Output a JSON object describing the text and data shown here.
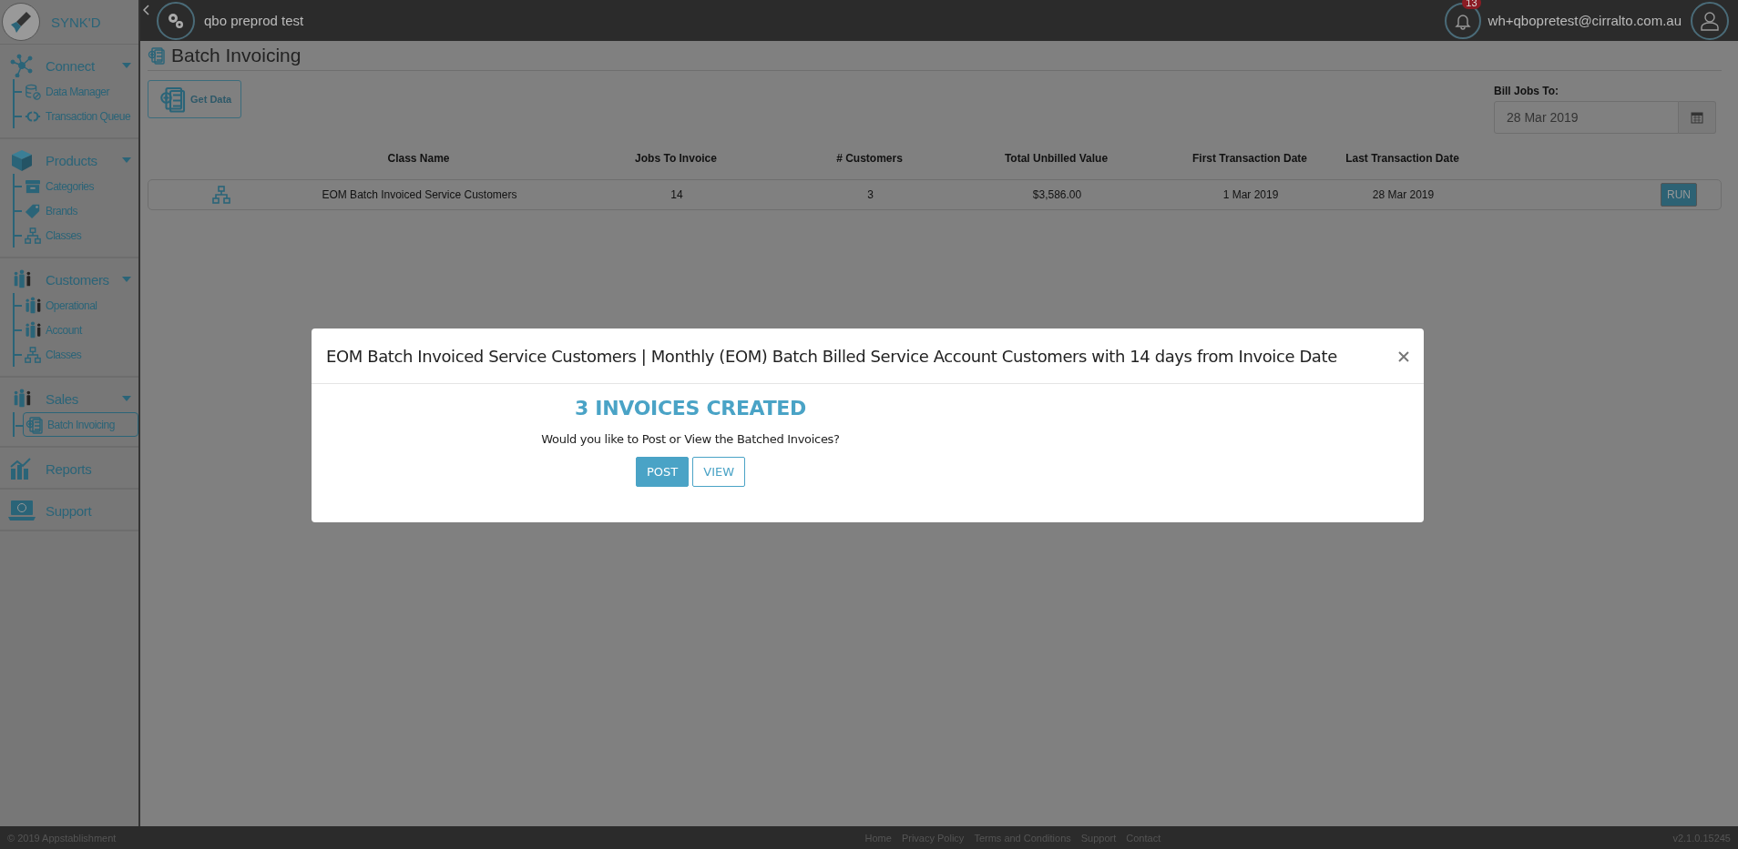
{
  "sidebar": {
    "brand": "SYNK'D",
    "groups": [
      {
        "label": "Connect",
        "expanded": true,
        "children": [
          {
            "label": "Data Manager",
            "selected": false
          },
          {
            "label": "Transaction Queue",
            "selected": false
          }
        ]
      },
      {
        "label": "Products",
        "expanded": true,
        "children": [
          {
            "label": "Categories",
            "selected": false
          },
          {
            "label": "Brands",
            "selected": false
          },
          {
            "label": "Classes",
            "selected": false
          }
        ]
      },
      {
        "label": "Customers",
        "expanded": true,
        "children": [
          {
            "label": "Operational",
            "selected": false
          },
          {
            "label": "Account",
            "selected": false
          },
          {
            "label": "Classes",
            "selected": false
          }
        ]
      },
      {
        "label": "Sales",
        "expanded": true,
        "children": [
          {
            "label": "Batch Invoicing",
            "selected": true
          }
        ]
      },
      {
        "label": "Reports"
      },
      {
        "label": "Support"
      }
    ]
  },
  "topbar": {
    "org": "qbo preprod test",
    "notifications": "13",
    "user": "wh+qbopretest@cirralto.com.au"
  },
  "page": {
    "title": "Batch Invoicing",
    "get_data": "Get Data",
    "bill_jobs_to": {
      "label": "Bill Jobs To:",
      "value": "28 Mar 2019"
    }
  },
  "table": {
    "columns": [
      "Class Name",
      "Jobs To Invoice",
      "# Customers",
      "Total Unbilled Value",
      "First Transaction Date",
      "Last Transaction Date"
    ],
    "rows": [
      {
        "cells": [
          "EOM Batch Invoiced Service Customers",
          "14",
          "3",
          "$3,586.00",
          "1 Mar 2019",
          "28 Mar 2019"
        ],
        "action": "RUN"
      }
    ]
  },
  "modal": {
    "title": "EOM Batch Invoiced Service Customers | Monthly (EOM) Batch Billed Service Account Customers with 14 days from Invoice Date",
    "heading": "3 INVOICES CREATED",
    "message": "Would you like to Post or View the Batched Invoices?",
    "buttons": [
      {
        "label": "POST",
        "kind": "primary"
      },
      {
        "label": "VIEW",
        "kind": "outline"
      }
    ]
  },
  "footer": {
    "copyright": "© 2019 Appstablishment",
    "links": [
      "Home",
      "Privacy Policy",
      "Terms and Conditions",
      "Support",
      "Contact"
    ],
    "version": "v2.1.0.15245"
  }
}
